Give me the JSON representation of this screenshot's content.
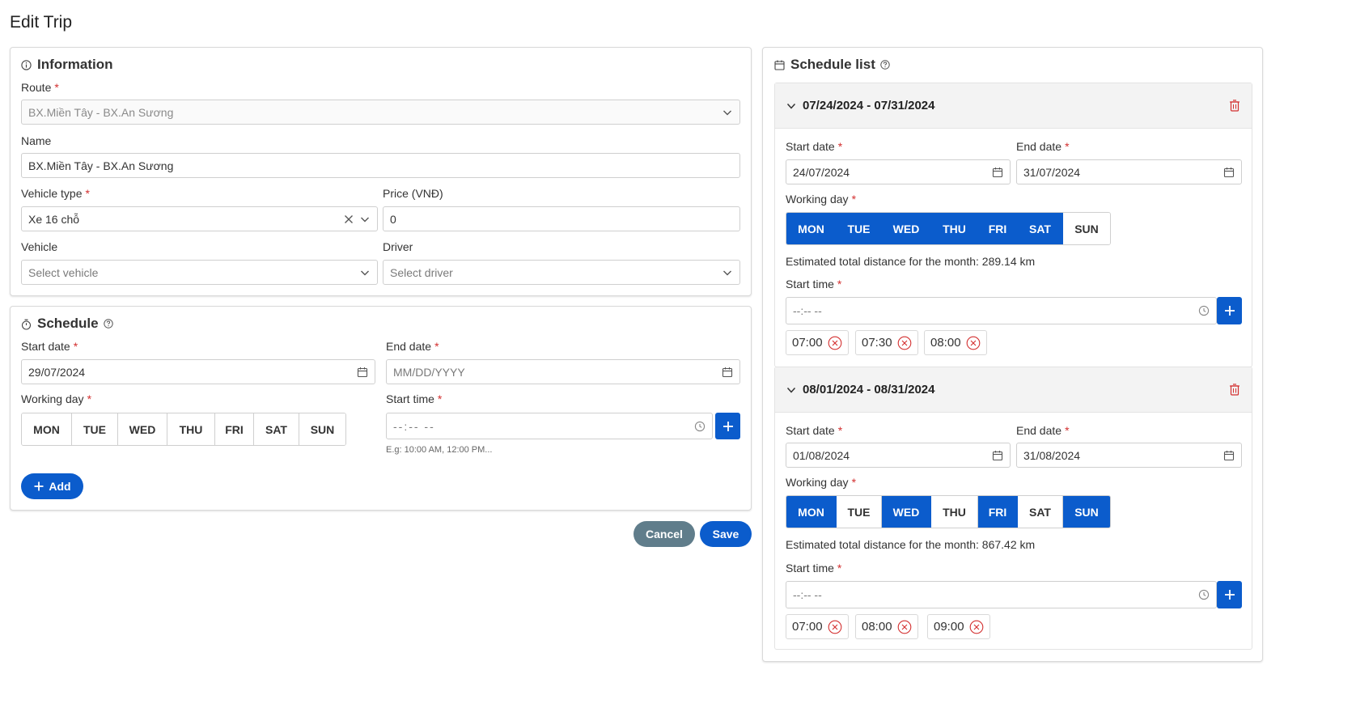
{
  "page_title": "Edit Trip",
  "colors": {
    "accent": "#0b5ccc",
    "danger": "#d32f2f",
    "cancel": "#607d8b"
  },
  "information": {
    "title": "Information",
    "route_label": "Route",
    "route_value": "BX.Miền Tây - BX.An Sương",
    "name_label": "Name",
    "name_value": "BX.Miền Tây - BX.An Sương",
    "vehicle_type_label": "Vehicle type",
    "vehicle_type_value": "Xe 16 chỗ",
    "price_label": "Price (VNĐ)",
    "price_value": "0",
    "vehicle_label": "Vehicle",
    "vehicle_placeholder": "Select vehicle",
    "driver_label": "Driver",
    "driver_placeholder": "Select driver"
  },
  "schedule": {
    "title": "Schedule",
    "start_date_label": "Start date",
    "start_date_value": "29/07/2024",
    "end_date_label": "End date",
    "end_date_placeholder": "MM/DD/YYYY",
    "working_day_label": "Working day",
    "days": [
      "MON",
      "TUE",
      "WED",
      "THU",
      "FRI",
      "SAT",
      "SUN"
    ],
    "start_time_label": "Start time",
    "start_time_placeholder": "--:-- --",
    "hint": "E.g: 10:00 AM, 12:00 PM...",
    "add_label": "Add"
  },
  "actions": {
    "cancel": "Cancel",
    "save": "Save"
  },
  "schedule_list": {
    "title": "Schedule list",
    "items": [
      {
        "range": "07/24/2024 - 07/31/2024",
        "start_date_label": "Start date",
        "start_date": "24/07/2024",
        "end_date_label": "End date",
        "end_date": "31/07/2024",
        "working_day_label": "Working day",
        "days": [
          "MON",
          "TUE",
          "WED",
          "THU",
          "FRI",
          "SAT",
          "SUN"
        ],
        "days_on": [
          true,
          true,
          true,
          true,
          true,
          true,
          false
        ],
        "distance_text": "Estimated total distance for the month: 289.14 km",
        "start_time_label": "Start time",
        "start_time_placeholder": "--:-- --",
        "times": [
          "07:00",
          "07:30",
          "08:00"
        ]
      },
      {
        "range": "08/01/2024 - 08/31/2024",
        "start_date_label": "Start date",
        "start_date": "01/08/2024",
        "end_date_label": "End date",
        "end_date": "31/08/2024",
        "working_day_label": "Working day",
        "days": [
          "MON",
          "TUE",
          "WED",
          "THU",
          "FRI",
          "SAT",
          "SUN"
        ],
        "days_on": [
          true,
          false,
          true,
          false,
          true,
          false,
          true
        ],
        "distance_text": "Estimated total distance for the month: 867.42 km",
        "start_time_label": "Start time",
        "start_time_placeholder": "--:-- --",
        "times": [
          "07:00",
          "08:00",
          "09:00"
        ]
      }
    ]
  }
}
